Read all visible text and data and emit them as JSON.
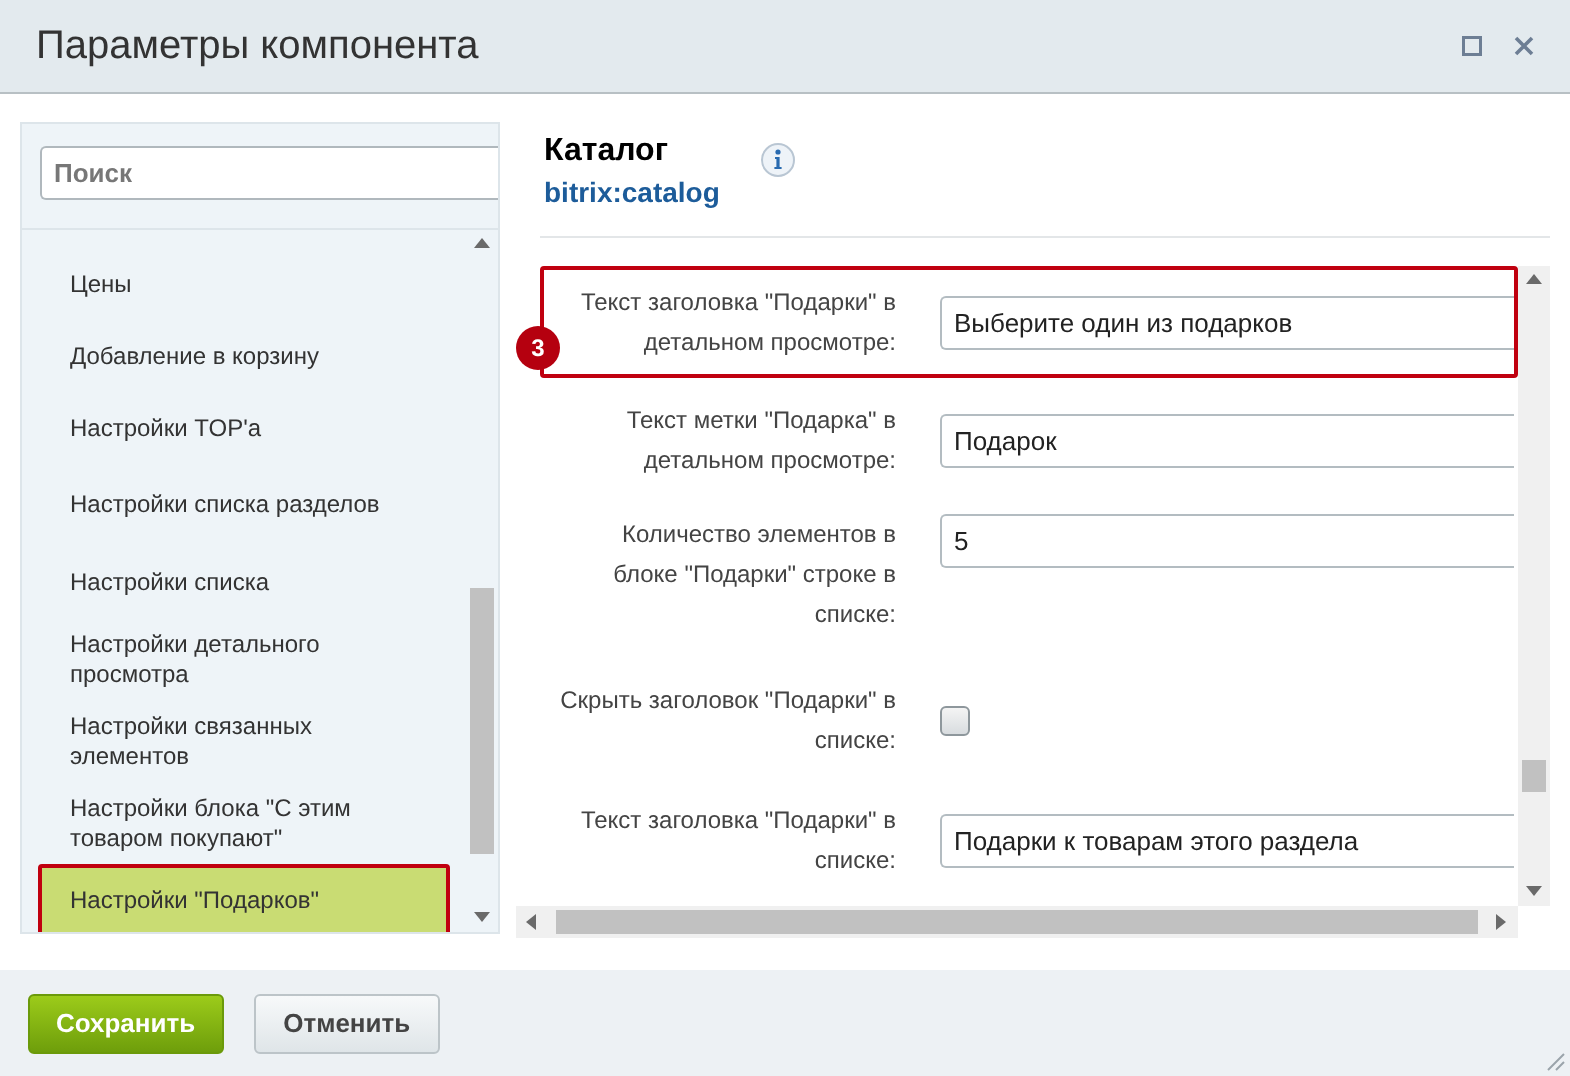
{
  "window": {
    "title": "Параметры компонента"
  },
  "sidebar": {
    "search": {
      "placeholder": "Поиск"
    },
    "items": [
      {
        "label": "Цены",
        "selected": false
      },
      {
        "label": "Добавление в корзину",
        "selected": false
      },
      {
        "label": "Настройки TOP'а",
        "selected": false
      },
      {
        "label": "Настройки списка разделов",
        "selected": false
      },
      {
        "label": "Настройки списка",
        "selected": false
      },
      {
        "label": "Настройки детального просмотра",
        "selected": false
      },
      {
        "label": "Настройки связанных элементов",
        "selected": false
      },
      {
        "label": "Настройки блока \"С этим товаром покупают\"",
        "selected": false
      },
      {
        "label": "Настройки \"Подарков\"",
        "selected": true
      }
    ]
  },
  "component": {
    "title": "Каталог",
    "code": "bitrix:catalog"
  },
  "fields": [
    {
      "kind": "text",
      "label": "Текст заголовка \"Подарки\" в детальном просмотре:",
      "value": "Выберите один из подарков",
      "highlighted": true,
      "marker": "3"
    },
    {
      "kind": "text",
      "label": "Текст метки \"Подарка\" в детальном просмотре:",
      "value": "Подарок",
      "highlighted": false
    },
    {
      "kind": "text",
      "label": "Количество элементов в блоке \"Подарки\" строке в списке:",
      "value": "5",
      "highlighted": false
    },
    {
      "kind": "checkbox",
      "label": "Скрыть заголовок \"Подарки\" в списке:",
      "checked": false,
      "highlighted": false
    },
    {
      "kind": "text",
      "label": "Текст заголовка \"Подарки\" в списке:",
      "value": "Подарки к товарам этого раздела",
      "highlighted": false
    }
  ],
  "buttons": [
    {
      "label": "Сохранить",
      "kind": "primary"
    },
    {
      "label": "Отменить",
      "kind": "secondary"
    }
  ]
}
